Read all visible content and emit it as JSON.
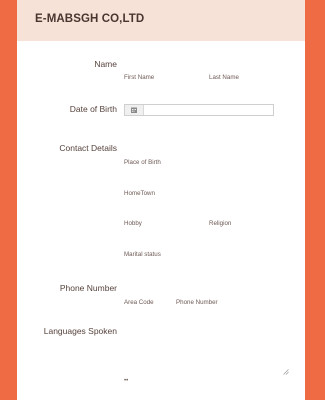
{
  "header": {
    "company": "E-MABSGH CO,LTD"
  },
  "form": {
    "name": {
      "label": "Name",
      "first": "First Name",
      "last": "Last Name"
    },
    "dob": {
      "label": "Date of Birth"
    },
    "contact": {
      "label": "Contact Details",
      "place_of_birth": "Place of Birth",
      "hometown": "HomeTown",
      "hobby": "Hobby",
      "religion": "Religion",
      "marital_status": "Marital status"
    },
    "phone": {
      "label": "Phone Number",
      "area_code": "Area Code",
      "number": "Phone Number"
    },
    "languages": {
      "label": "Languages Spoken"
    }
  },
  "icons": {
    "calendar": "calendar-icon",
    "resize": "resize-handle-icon",
    "more": "ellipsis-icon"
  },
  "colors": {
    "background": "#ef6b43",
    "header": "#f6e2d6",
    "card": "#ffffff",
    "text": "#57433d"
  }
}
